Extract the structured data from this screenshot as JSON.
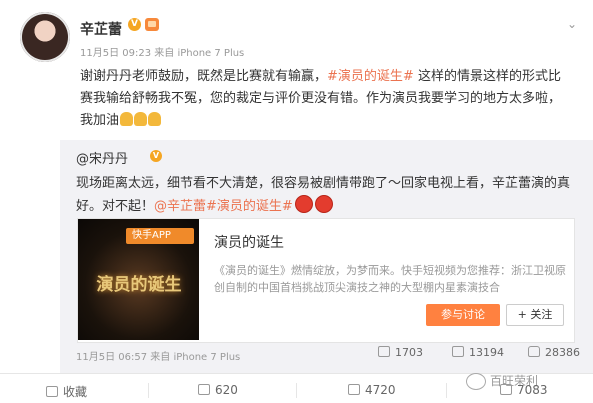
{
  "post": {
    "author": "辛芷蕾",
    "meta": "11月5日 09:23 来自 iPhone 7 Plus",
    "text_before": "谢谢丹丹老师鼓励，既然是比赛就有输赢，",
    "topic": "#演员的诞生#",
    "text_after": " 这样的情景这样的形式比赛我输给舒畅我不冤，您的裁定与评价更没有错。作为演员我要学习的地方太多啦，我加油"
  },
  "repost": {
    "author": "@宋丹丹",
    "text": "现场距离太远，细节看不大清楚，很容易被剧情带跑了～回家电视上看，辛芷蕾演的真好。对不起！",
    "mention": "@辛芷蕾",
    "topic": "#演员的诞生#",
    "card": {
      "badge": "快手APP",
      "thumb_title": "演员的诞生",
      "title": "演员的诞生",
      "desc": "《演员的诞生》燃情绽放，为梦而来。快手短视频为您推荐：浙江卫视原创自制的中国首档挑战顶尖演技之神的大型棚内星素演技合",
      "join_label": "参与讨论",
      "follow_label": "+ 关注"
    },
    "meta": "11月5日 06:57 来自 iPhone 7 Plus",
    "stats": {
      "reposts": "1703",
      "comments": "13194",
      "likes": "28386"
    }
  },
  "bar": {
    "favorite": "收藏",
    "reposts": "620",
    "comments": "4720",
    "likes": "7083"
  },
  "watermark": "百旺荣利",
  "colors": {
    "accent": "#eb7350",
    "button": "#ff8140",
    "badge": "#f5a623"
  }
}
